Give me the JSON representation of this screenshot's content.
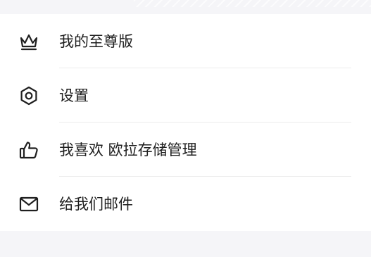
{
  "menu": {
    "items": [
      {
        "label": "我的至尊版",
        "icon": "crown-icon"
      },
      {
        "label": "设置",
        "icon": "settings-hexagon-icon"
      },
      {
        "label": "我喜欢 欧拉存储管理",
        "icon": "thumbs-up-icon"
      },
      {
        "label": "给我们邮件",
        "icon": "mail-icon"
      }
    ]
  },
  "colors": {
    "page_background": "#f5f5f8",
    "card_background": "#ffffff",
    "text": "#1f1f1f",
    "divider": "#ececec"
  }
}
